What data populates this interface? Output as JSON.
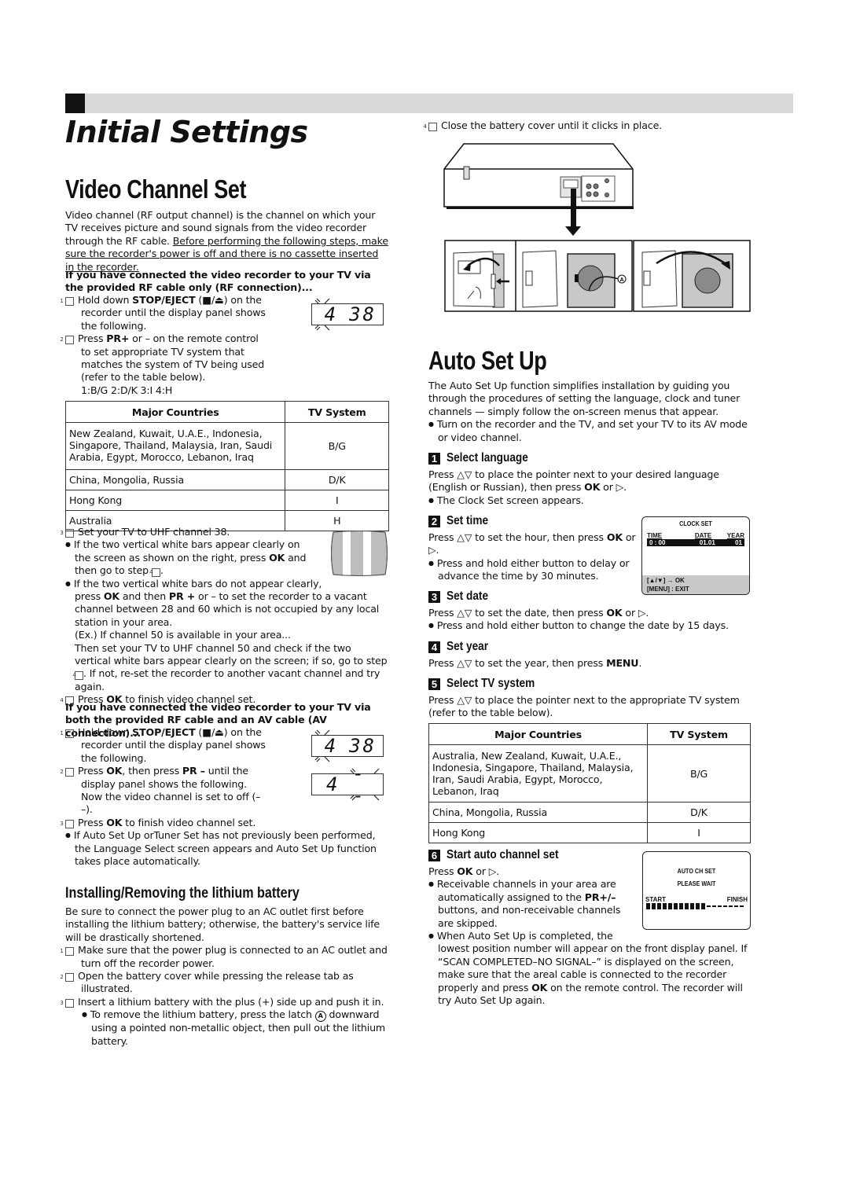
{
  "header": {
    "title": "Initial Settings"
  },
  "video_channel_set": {
    "heading": "Video Channel Set",
    "intro_plain": "Video channel (RF output channel) is the channel on which your TV receives picture and sound signals from the video recorder through the RF cable. ",
    "intro_underlined": "Before performing the following steps, make sure the recorder's power is off and there is no cassette inserted in the recorder.",
    "rf_connection": {
      "heading": "If you have connected the video recorder to your TV via the provided RF cable only (RF connection)...",
      "steps": [
        {
          "num": "1",
          "pre": "Hold down ",
          "bold": "STOP/EJECT",
          "post": " (■/⏏) on the recorder until the display panel shows the following."
        },
        {
          "num": "2",
          "pre": "Press ",
          "bold": "PR+",
          "post": " or – on the remote control to set appropriate TV system that matches the system of TV being used (refer to the table below).",
          "extra": "1:B/G  2:D/K  3:I  4:H"
        }
      ],
      "display_panel": {
        "left": "4",
        "right": "38"
      },
      "table": {
        "headers": [
          "Major Countries",
          "TV System"
        ],
        "rows": [
          {
            "countries": "New Zealand, Kuwait, U.A.E., Indonesia, Singapore, Thailand, Malaysia, Iran, Saudi Arabia, Egypt, Morocco, Lebanon, Iraq",
            "system": "B/G"
          },
          {
            "countries": "China, Mongolia, Russia",
            "system": "D/K"
          },
          {
            "countries": "Hong Kong",
            "system": "I"
          },
          {
            "countries": "Australia",
            "system": "H"
          }
        ]
      },
      "step3": {
        "num": "3",
        "text": "Set your TV to UHF channel 38."
      },
      "bullet1": {
        "pre": "If the two vertical white bars appear clearly on the screen as shown on the right, press ",
        "bold": "OK",
        "post": " and then go to step ",
        "ref": "4",
        "end": "."
      },
      "bullet2": {
        "line1": "If the two vertical white bars do not appear clearly,",
        "pre": "press ",
        "bold1": "OK",
        "mid": " and then ",
        "bold2": "PR +",
        "post": " or – to set the recorder to a vacant channel between 28 and 60 which is not occupied by any local station in your area.",
        "example": "(Ex.) If channel 50 is available in your area...",
        "then_pre": "Then set your TV to UHF channel 50 and check if the two vertical white bars appear clearly on the screen; if so, go to step ",
        "then_ref": "4",
        "then_post": ". If not, re-set the recorder to another vacant channel and try again."
      },
      "step4": {
        "num": "4",
        "pre": "Press ",
        "bold": "OK",
        "post": " to finish video channel set."
      }
    },
    "av_connection": {
      "heading": "If you have connected the video recorder to your TV via both the provided RF cable and an AV cable (AV connection)...",
      "steps": [
        {
          "num": "1",
          "pre": "Hold down ",
          "bold": "STOP/EJECT",
          "post": " (■/⏏) on the recorder until the display panel shows the following."
        },
        {
          "num": "2",
          "pre": "Press ",
          "bold": "OK",
          "mid": ", then press ",
          "bold2": "PR –",
          "post": " until the display panel shows the following. Now the video channel is set to off (– –)."
        },
        {
          "num": "3",
          "pre": "Press ",
          "bold": "OK",
          "post": " to finish video channel set."
        }
      ],
      "display_panel_1": {
        "left": "4",
        "right": "38"
      },
      "display_panel_2": {
        "left": "4",
        "right": "--"
      },
      "bullet": "If Auto Set Up orTuner Set has not previously been performed, the Language Select screen appears and Auto Set Up function takes place automatically."
    }
  },
  "battery": {
    "heading": "Installing/Removing the lithium battery",
    "intro": "Be sure to connect the power plug to an AC outlet first before installing the lithium battery; otherwise, the battery's service life will be drastically shortened.",
    "steps": [
      {
        "num": "1",
        "text": "Make sure that the power plug is connected to an AC outlet and turn off the recorder power."
      },
      {
        "num": "2",
        "text": "Open the battery cover while pressing the release tab as illustrated."
      },
      {
        "num": "3",
        "text": "Insert a lithium battery with the plus (+) side up and push it in."
      },
      {
        "num": "4",
        "text": "Close the battery cover until it clicks in place."
      }
    ],
    "sub_bullet": {
      "pre": "To remove the lithium battery, press the latch ",
      "latch": "A",
      "post": " downward using a pointed non-metallic object, then pull out the lithium battery."
    },
    "diagram_label": "A"
  },
  "auto_set_up": {
    "heading": "Auto Set Up",
    "intro": "The Auto Set Up function simplifies installation by guiding you through the procedures of setting the language, clock and tuner channels — simply follow the on-screen menus that appear.",
    "bullet": "Turn on the recorder and the TV, and set your TV to its AV mode or video channel.",
    "steps": [
      {
        "num": "1",
        "title": "Select language",
        "text_pre": "Press △▽ to place the pointer next to your desired language (English or Russian), then press ",
        "text_bold": "OK",
        "text_post": " or ▷.",
        "bullet": "The Clock Set screen appears."
      },
      {
        "num": "2",
        "title": "Set time",
        "text_pre": "Press △▽ to set the hour, then press ",
        "text_bold": "OK",
        "text_post": " or ▷.",
        "bullet": "Press and hold either button to delay or advance the time by 30 minutes."
      },
      {
        "num": "3",
        "title": "Set date",
        "text_pre": "Press △▽ to set the date, then press ",
        "text_bold": "OK",
        "text_post": " or ▷.",
        "bullet": "Press and hold either button to change the date by 15 days."
      },
      {
        "num": "4",
        "title": "Set year",
        "text_pre": "Press △▽ to set the year, then press ",
        "text_bold": "MENU",
        "text_post": "."
      },
      {
        "num": "5",
        "title": "Select TV system",
        "text": "Press △▽ to place the pointer next to the appropriate TV system (refer to the table below)."
      },
      {
        "num": "6",
        "title": "Start auto channel set",
        "text_pre": "Press ",
        "text_bold": "OK",
        "text_post": " or ▷.",
        "bullet1_pre": "Receivable channels in your area are automatically assigned to the ",
        "bullet1_bold": "PR+/–",
        "bullet1_post": " buttons, and non-receivable channels are skipped.",
        "bullet2_line1": "When Auto Set Up is completed, the",
        "bullet2_pre": "lowest position number will appear on the front display panel. If “SCAN COMPLETED–NO SIGNAL–” is displayed on the screen, make sure that the areal cable is connected to the recorder properly and press ",
        "bullet2_bold": "OK",
        "bullet2_post": " on the remote control. The recorder will try Auto Set Up again."
      }
    ],
    "table": {
      "headers": [
        "Major Countries",
        "TV System"
      ],
      "rows": [
        {
          "countries": "Australia, New Zealand, Kuwait, U.A.E., Indonesia, Singapore, Thailand, Malaysia, Iran, Saudi Arabia, Egypt, Morocco, Lebanon, Iraq",
          "system": "B/G"
        },
        {
          "countries": "China, Mongolia, Russia",
          "system": "D/K"
        },
        {
          "countries": "Hong Kong",
          "system": "I"
        }
      ]
    },
    "clock_set_screen": {
      "title": "CLOCK SET",
      "col_time": "TIME",
      "col_date": "DATE",
      "col_year": "YEAR",
      "time": "0 : 00",
      "date": "01.01",
      "year": "01",
      "hint1": "[▲/▼] → OK",
      "hint2": "[MENU] : EXIT"
    },
    "auto_ch_screen": {
      "title": "AUTO CH SET",
      "status": "PLEASE WAIT",
      "start_label": "START",
      "finish_label": "FINISH",
      "progress_filled_blocks": 11,
      "progress_total_blocks": 18
    }
  }
}
